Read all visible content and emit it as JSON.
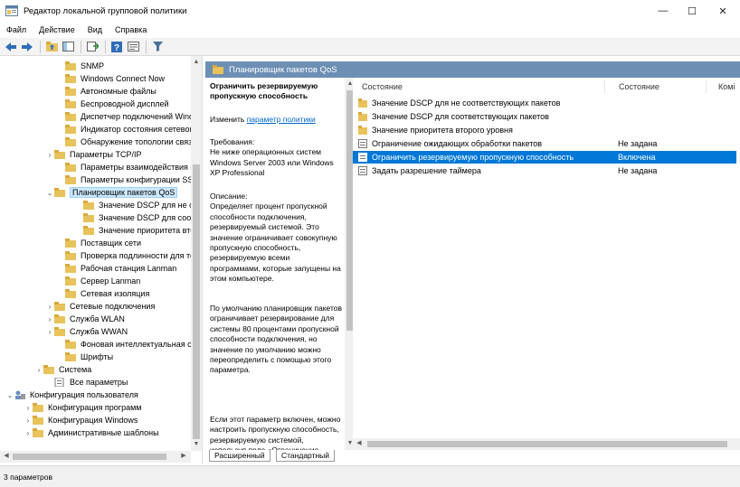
{
  "window": {
    "title": "Редактор локальной групповой политики",
    "minimize": "—",
    "maximize": "☐",
    "close": "✕"
  },
  "menu": [
    "Файл",
    "Действие",
    "Вид",
    "Справка"
  ],
  "toolbar": {
    "icons": [
      "back-icon",
      "forward-icon",
      "up-folder-icon",
      "show-tree-icon",
      "export-list-icon",
      "help-icon",
      "properties-icon",
      "filter-icon"
    ]
  },
  "tree": {
    "items": [
      {
        "label": "SNMP",
        "expander": ""
      },
      {
        "label": "Windows Connect Now",
        "expander": ""
      },
      {
        "label": "Автономные файлы",
        "expander": ""
      },
      {
        "label": "Беспроводной дисплей",
        "expander": ""
      },
      {
        "label": "Диспетчер подключений Wind",
        "expander": ""
      },
      {
        "label": "Индикатор состояния сетевог",
        "expander": ""
      },
      {
        "label": "Обнаружение топологии связ",
        "expander": ""
      },
      {
        "label": "Параметры TCP/IP",
        "expander": "›"
      },
      {
        "label": "Параметры взаимодействия с",
        "expander": ""
      },
      {
        "label": "Параметры конфигурации SS",
        "expander": ""
      },
      {
        "label": "Планировщик пакетов QoS",
        "expander": "⌄"
      },
      {
        "label": "Значение DSCP для не соо",
        "expander": ""
      },
      {
        "label": "Значение DSCP для соотве",
        "expander": ""
      },
      {
        "label": "Значение приоритета втор",
        "expander": ""
      },
      {
        "label": "Поставщик сети",
        "expander": ""
      },
      {
        "label": "Проверка подлинности для те",
        "expander": ""
      },
      {
        "label": "Рабочая станция Lanman",
        "expander": ""
      },
      {
        "label": "Сервер Lanman",
        "expander": ""
      },
      {
        "label": "Сетевая изоляция",
        "expander": ""
      },
      {
        "label": "Сетевые подключения",
        "expander": "›"
      },
      {
        "label": "Служба WLAN",
        "expander": "›"
      },
      {
        "label": "Служба WWAN",
        "expander": "›"
      },
      {
        "label": "Фоновая интеллектуальная с",
        "expander": ""
      },
      {
        "label": "Шрифты",
        "expander": ""
      },
      {
        "label": "Система",
        "expander": "›"
      },
      {
        "label": "Все параметры",
        "expander": ""
      },
      {
        "label": "Конфигурация пользователя",
        "expander": "⌄"
      },
      {
        "label": "Конфигурация программ",
        "expander": "›"
      },
      {
        "label": "Конфигурация Windows",
        "expander": "›"
      },
      {
        "label": "Административные шаблоны",
        "expander": "›"
      }
    ]
  },
  "details": {
    "header_title": "Планировщик пакетов QoS",
    "policy_title": "Ограничить резервируемую пропускную способность",
    "edit_prefix": "Изменить ",
    "edit_link": "параметр политики",
    "requirements": "Требования:\nНе ниже операционных систем Windows Server 2003 или Windows XP Professional",
    "description": "Описание:\nОпределяет процент пропускной способности подключения, резервируемый системой. Это значение ограничивает совокупную пропускную способность, резервируемую всеми программами, которые запущены на этом компьютере.",
    "default_text": "По умолчанию планировщик пакетов ограничивает резервирование для системы 80 процентами пропускной способности подключения, но значение по умолчанию можно переопределить с помощью этого параметра.",
    "enabled_text": "Если этот параметр включен, можно настроить пропускную способность, резервируемую системой, используя поле «Ограничение пропускной"
  },
  "list": {
    "columns": [
      "Состояние",
      "Состояние",
      "Комі"
    ],
    "rows": [
      {
        "name": "Значение DSCP для не соответствующих пакетов",
        "state": "",
        "kind": "folder",
        "selected": false
      },
      {
        "name": "Значение DSCP для соответствующих пакетов",
        "state": "",
        "kind": "folder",
        "selected": false
      },
      {
        "name": "Значение приоритета второго уровня",
        "state": "",
        "kind": "folder",
        "selected": false
      },
      {
        "name": "Ограничение ожидающих обработки пакетов",
        "state": "Не задана",
        "kind": "setting",
        "selected": false
      },
      {
        "name": "Ограничить резервируемую пропускную способность",
        "state": "Включена",
        "kind": "setting",
        "selected": true
      },
      {
        "name": "Задать разрешение таймера",
        "state": "Не задана",
        "kind": "setting",
        "selected": false
      }
    ]
  },
  "tabs": [
    "Расширенный",
    "Стандартный"
  ],
  "status": {
    "text": "3 параметров"
  },
  "colors": {
    "selection": "#0078d7",
    "header_band": "#6d8fb4",
    "folder": "#e8c25b",
    "link": "#0066cc"
  }
}
